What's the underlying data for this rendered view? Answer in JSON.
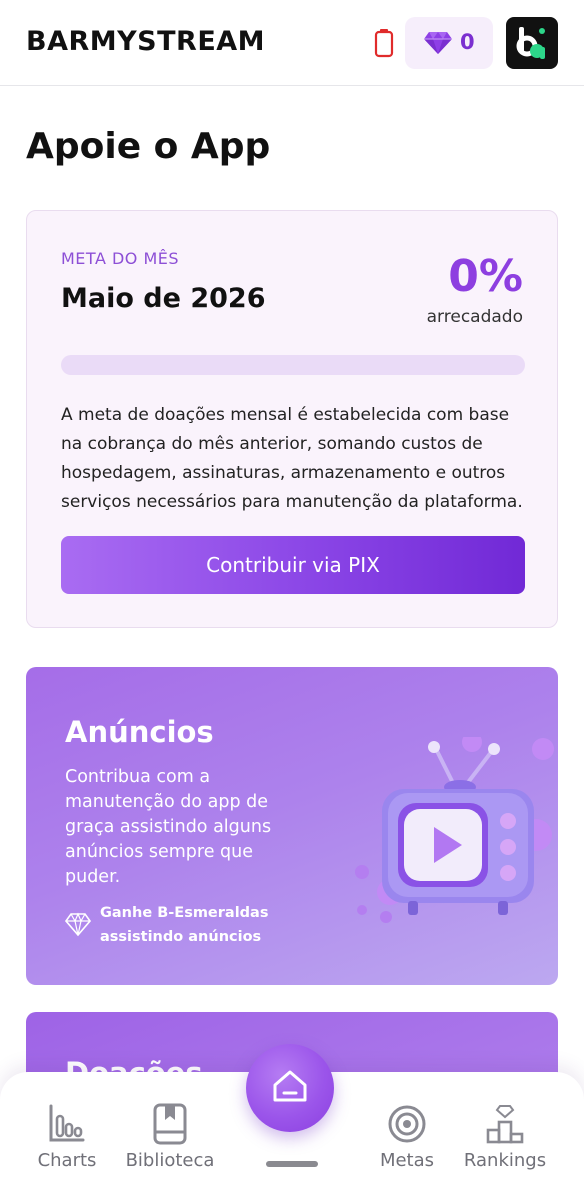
{
  "header": {
    "brand": "BARMYSTREAM",
    "gem_count": "0",
    "battery_icon": "battery-low-icon",
    "gem_icon": "gem-icon",
    "logo": "app-logo",
    "accent": "#7b2fd0"
  },
  "page": {
    "title": "Apoie o App"
  },
  "goal": {
    "eyebrow": "META DO MÊS",
    "month": "Maio de 2026",
    "percent": "0%",
    "percent_value": 0,
    "raised_label": "arrecadado",
    "description": "A meta de doações mensal é estabelecida com base na cobrança do mês anterior, somando custos de hospedagem, assinaturas, armazenamento e outros serviços necessários para manutenção da plataforma.",
    "button_label": "Contribuir via PIX"
  },
  "ads": {
    "title": "Anúncios",
    "description": "Contribua com a manutenção do app de graça assistindo alguns anúncios sempre que puder.",
    "perk": "Ganhe B-Esmeraldas assistindo anúncios",
    "perk_icon": "diamond-outline-icon",
    "illustration": "tv-play-icon"
  },
  "donation": {
    "title": "Doações"
  },
  "nav": {
    "items": [
      {
        "label": "Charts",
        "icon": "charts-icon"
      },
      {
        "label": "Biblioteca",
        "icon": "library-icon"
      },
      {
        "label": "Metas",
        "icon": "target-icon"
      },
      {
        "label": "Rankings",
        "icon": "podium-icon"
      }
    ],
    "home_icon": "home-icon"
  },
  "colors": {
    "purple_primary": "#8a45e6",
    "card_bg": "#faf3fc",
    "nav_gray": "#707078"
  }
}
